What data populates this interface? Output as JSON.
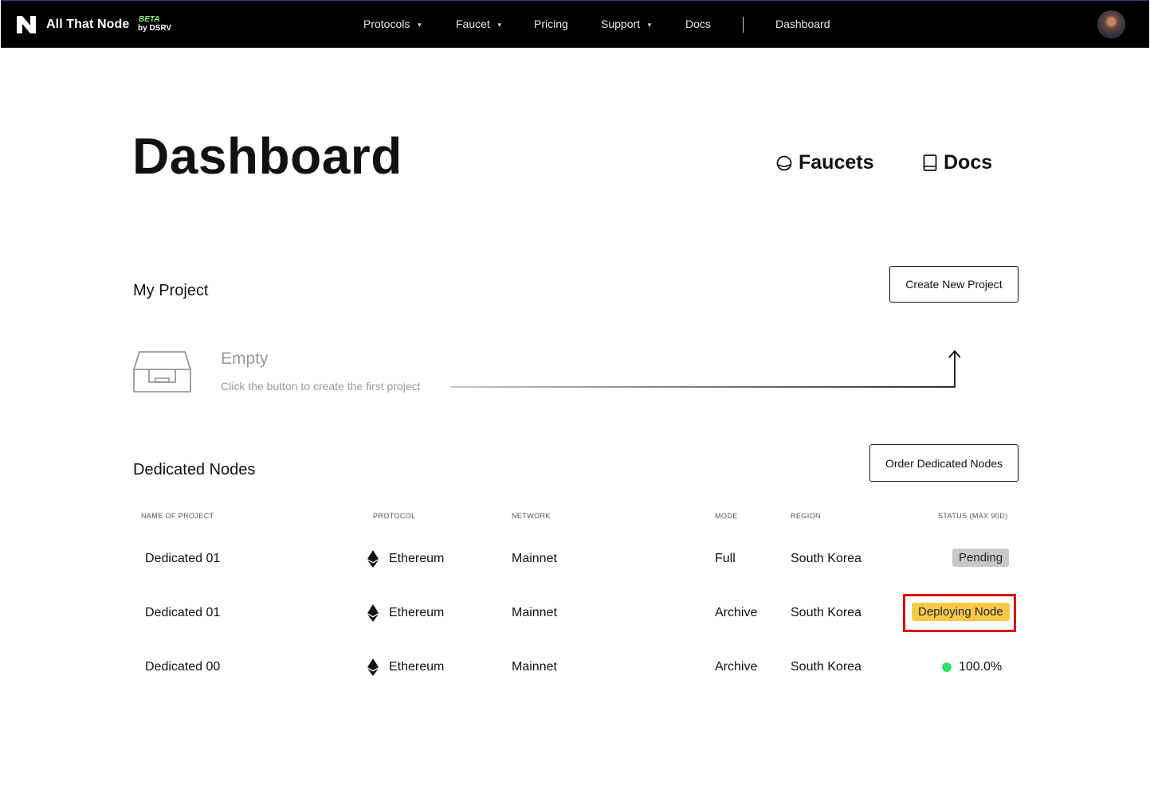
{
  "nav": {
    "brand": "All That Node",
    "beta": "BETA",
    "by": "by DSRV",
    "items": [
      {
        "label": "Protocols",
        "dropdown": true
      },
      {
        "label": "Faucet",
        "dropdown": true
      },
      {
        "label": "Pricing",
        "dropdown": false
      },
      {
        "label": "Support",
        "dropdown": true
      },
      {
        "label": "Docs",
        "dropdown": false
      },
      {
        "label": "Dashboard",
        "dropdown": false
      }
    ],
    "caret": "▼"
  },
  "header": {
    "title": "Dashboard",
    "faucets_label": "Faucets",
    "docs_label": "Docs"
  },
  "my_project": {
    "title": "My Project",
    "create_button": "Create New Project",
    "empty_title": "Empty",
    "empty_desc": "Click the button to create the first project"
  },
  "dedicated": {
    "title": "Dedicated Nodes",
    "order_button": "Order Dedicated Nodes",
    "columns": [
      "NAME OF PROJECT",
      "PROTOCOL",
      "NETWORK",
      "MODE",
      "REGION",
      "STATUS (MAX 90D)"
    ],
    "rows": [
      {
        "name": "Dedicated 01",
        "protocol": "Ethereum",
        "network": "Mainnet",
        "mode": "Full",
        "region": "South Korea",
        "status": "Pending"
      },
      {
        "name": "Dedicated 01",
        "protocol": "Ethereum",
        "network": "Mainnet",
        "mode": "Archive",
        "region": "South Korea",
        "status": "Deploying Node"
      },
      {
        "name": "Dedicated 00",
        "protocol": "Ethereum",
        "network": "Mainnet",
        "mode": "Archive",
        "region": "South Korea",
        "status": "100.0%"
      }
    ]
  },
  "colors": {
    "pending_badge": "#c8c8c8",
    "deploying_badge": "#f7c948",
    "healthy_dot": "#2ee26a",
    "highlight_box": "#e00000"
  }
}
